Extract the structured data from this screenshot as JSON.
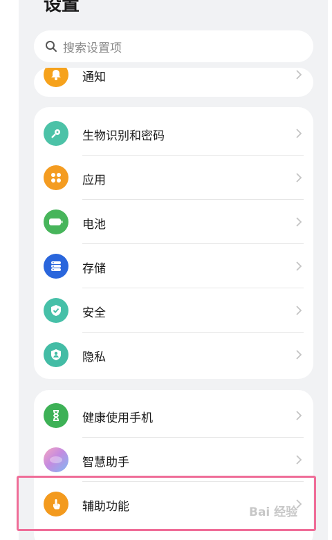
{
  "header": {
    "title": "设置"
  },
  "search": {
    "placeholder": "搜索设置项"
  },
  "top_card": {
    "items": [
      {
        "label": "通知",
        "icon": "bell-icon",
        "color": "#f6a21c"
      }
    ]
  },
  "security_card": {
    "items": [
      {
        "label": "生物识别和密码",
        "icon": "key-icon",
        "color": "#4cc2a7"
      },
      {
        "label": "应用",
        "icon": "apps-icon",
        "color": "#f49c21"
      },
      {
        "label": "电池",
        "icon": "battery-icon",
        "color": "#47b55b"
      },
      {
        "label": "存储",
        "icon": "storage-icon",
        "color": "#2a66dc"
      },
      {
        "label": "安全",
        "icon": "shield-icon",
        "color": "#46c0a8"
      },
      {
        "label": "隐私",
        "icon": "privacy-icon",
        "color": "#43bca5"
      }
    ]
  },
  "assist_card": {
    "items": [
      {
        "label": "健康使用手机",
        "icon": "hourglass-icon",
        "color": "#3db156"
      },
      {
        "label": "智慧助手",
        "icon": "assistant-icon",
        "color": "#c58be0"
      },
      {
        "label": "辅助功能",
        "icon": "hand-icon",
        "color": "#f39a1e"
      }
    ]
  },
  "watermark": {
    "text": "Bai 经验"
  }
}
